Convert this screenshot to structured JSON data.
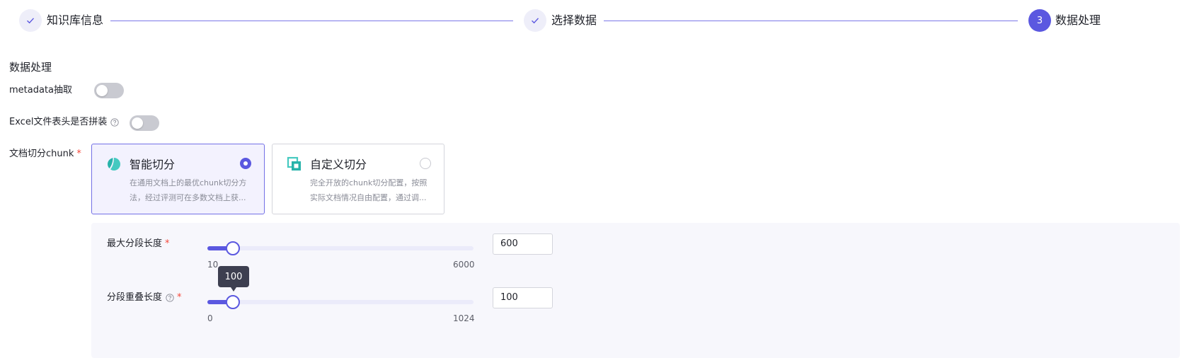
{
  "steps": [
    {
      "label": "知识库信息",
      "status": "done"
    },
    {
      "label": "选择数据",
      "status": "done"
    },
    {
      "label": "数据处理",
      "status": "active",
      "number": "3"
    }
  ],
  "section_title": "数据处理",
  "metadata_extract": {
    "label": "metadata抽取",
    "enabled": false
  },
  "excel_header": {
    "label": "Excel文件表头是否拼装",
    "enabled": false
  },
  "chunk": {
    "label": "文档切分chunk",
    "required_mark": "*",
    "options": [
      {
        "title": "智能切分",
        "desc_line1": "在通用文档上的最优chunk切分方",
        "desc_line2": "法，经过评测可在多数文档上获...",
        "selected": true,
        "icon": "smart-split-icon"
      },
      {
        "title": "自定义切分",
        "desc_line1": "完全开放的chunk切分配置，按照",
        "desc_line2": "实际文档情况自由配置，通过调...",
        "selected": false,
        "icon": "custom-split-icon"
      }
    ]
  },
  "max_segment": {
    "label": "最大分段长度",
    "required_mark": "*",
    "min": "10",
    "max": "6000",
    "value": "600"
  },
  "overlap": {
    "label": "分段重叠长度",
    "required_mark": "*",
    "min": "0",
    "max": "1024",
    "value": "100",
    "tooltip": "100"
  },
  "colors": {
    "accent": "#5b58e0",
    "required": "#f5483b"
  }
}
